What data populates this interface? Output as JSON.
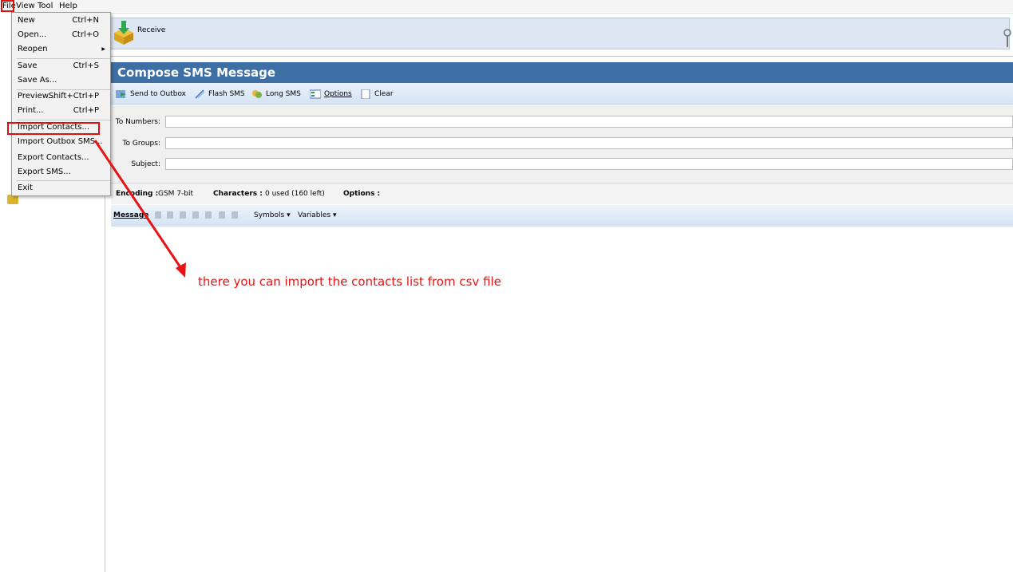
{
  "menubar": {
    "items": [
      "File",
      "View",
      "Tool",
      "Help"
    ]
  },
  "file_menu": {
    "items": [
      {
        "label": "New",
        "shortcut": "Ctrl+N"
      },
      {
        "label": "Open...",
        "shortcut": "Ctrl+O"
      },
      {
        "label": "Reopen",
        "shortcut": "",
        "submenu": true
      },
      {
        "label": "Save",
        "shortcut": "Ctrl+S"
      },
      {
        "label": "Save As...",
        "shortcut": ""
      },
      {
        "label": "Preview...",
        "shortcut": "Shift+Ctrl+P"
      },
      {
        "label": "Print...",
        "shortcut": "Ctrl+P"
      },
      {
        "label": "Import Contacts...",
        "shortcut": ""
      },
      {
        "label": "Import Outbox SMS...",
        "shortcut": ""
      },
      {
        "label": "Export Contacts...",
        "shortcut": ""
      },
      {
        "label": "Export SMS...",
        "shortcut": ""
      },
      {
        "label": "Exit",
        "shortcut": ""
      }
    ],
    "highlighted": "Import Contacts..."
  },
  "toolbar": {
    "receive_label": "Receive"
  },
  "compose": {
    "title": "Compose SMS Message",
    "toolbar": [
      "Send to Outbox",
      "Flash SMS",
      "Long SMS",
      "Options",
      "Clear"
    ],
    "fields": {
      "to_numbers": "To Numbers:",
      "to_groups": "To Groups:",
      "subject": "Subject:"
    },
    "encoding": {
      "encoding_label": "Encoding :",
      "encoding_value": "GSM 7-bit",
      "characters_label": "Characters :",
      "characters_value": "0 used (160 left)",
      "options_label": "Options :"
    },
    "message": {
      "label": "Message",
      "symbols": "Symbols",
      "variables": "Variables"
    }
  },
  "annotation": {
    "text": "there you can import the contacts list from csv file"
  },
  "colors": {
    "header": "#3d6fa4",
    "annotation": "#e81313"
  }
}
